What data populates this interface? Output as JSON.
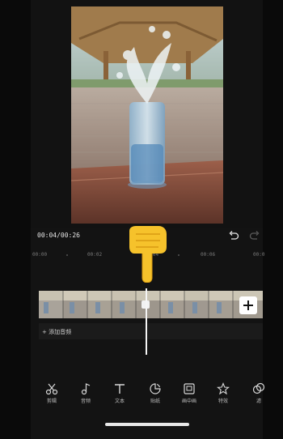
{
  "playback": {
    "time": "00:04/00:26"
  },
  "ruler": {
    "labels": [
      "00:00",
      "00:02",
      "00:04",
      "00:06",
      "00:0"
    ]
  },
  "timeline": {
    "audio_label": "+ 添加音频",
    "split_icon": "scissor-marker",
    "add_clip_icon": "plus-icon"
  },
  "toolbar": {
    "items": [
      {
        "label": "剪辑",
        "icon": "scissors-icon"
      },
      {
        "label": "音频",
        "icon": "music-note-icon"
      },
      {
        "label": "文本",
        "icon": "text-icon"
      },
      {
        "label": "贴纸",
        "icon": "sticker-icon"
      },
      {
        "label": "画中画",
        "icon": "picture-in-picture-icon"
      },
      {
        "label": "特效",
        "icon": "effects-star-icon"
      },
      {
        "label": "滤",
        "icon": "filter-icon"
      }
    ]
  },
  "colors": {
    "background": "#131313",
    "accent": "#ffffff",
    "hand": "#f6c22b"
  }
}
